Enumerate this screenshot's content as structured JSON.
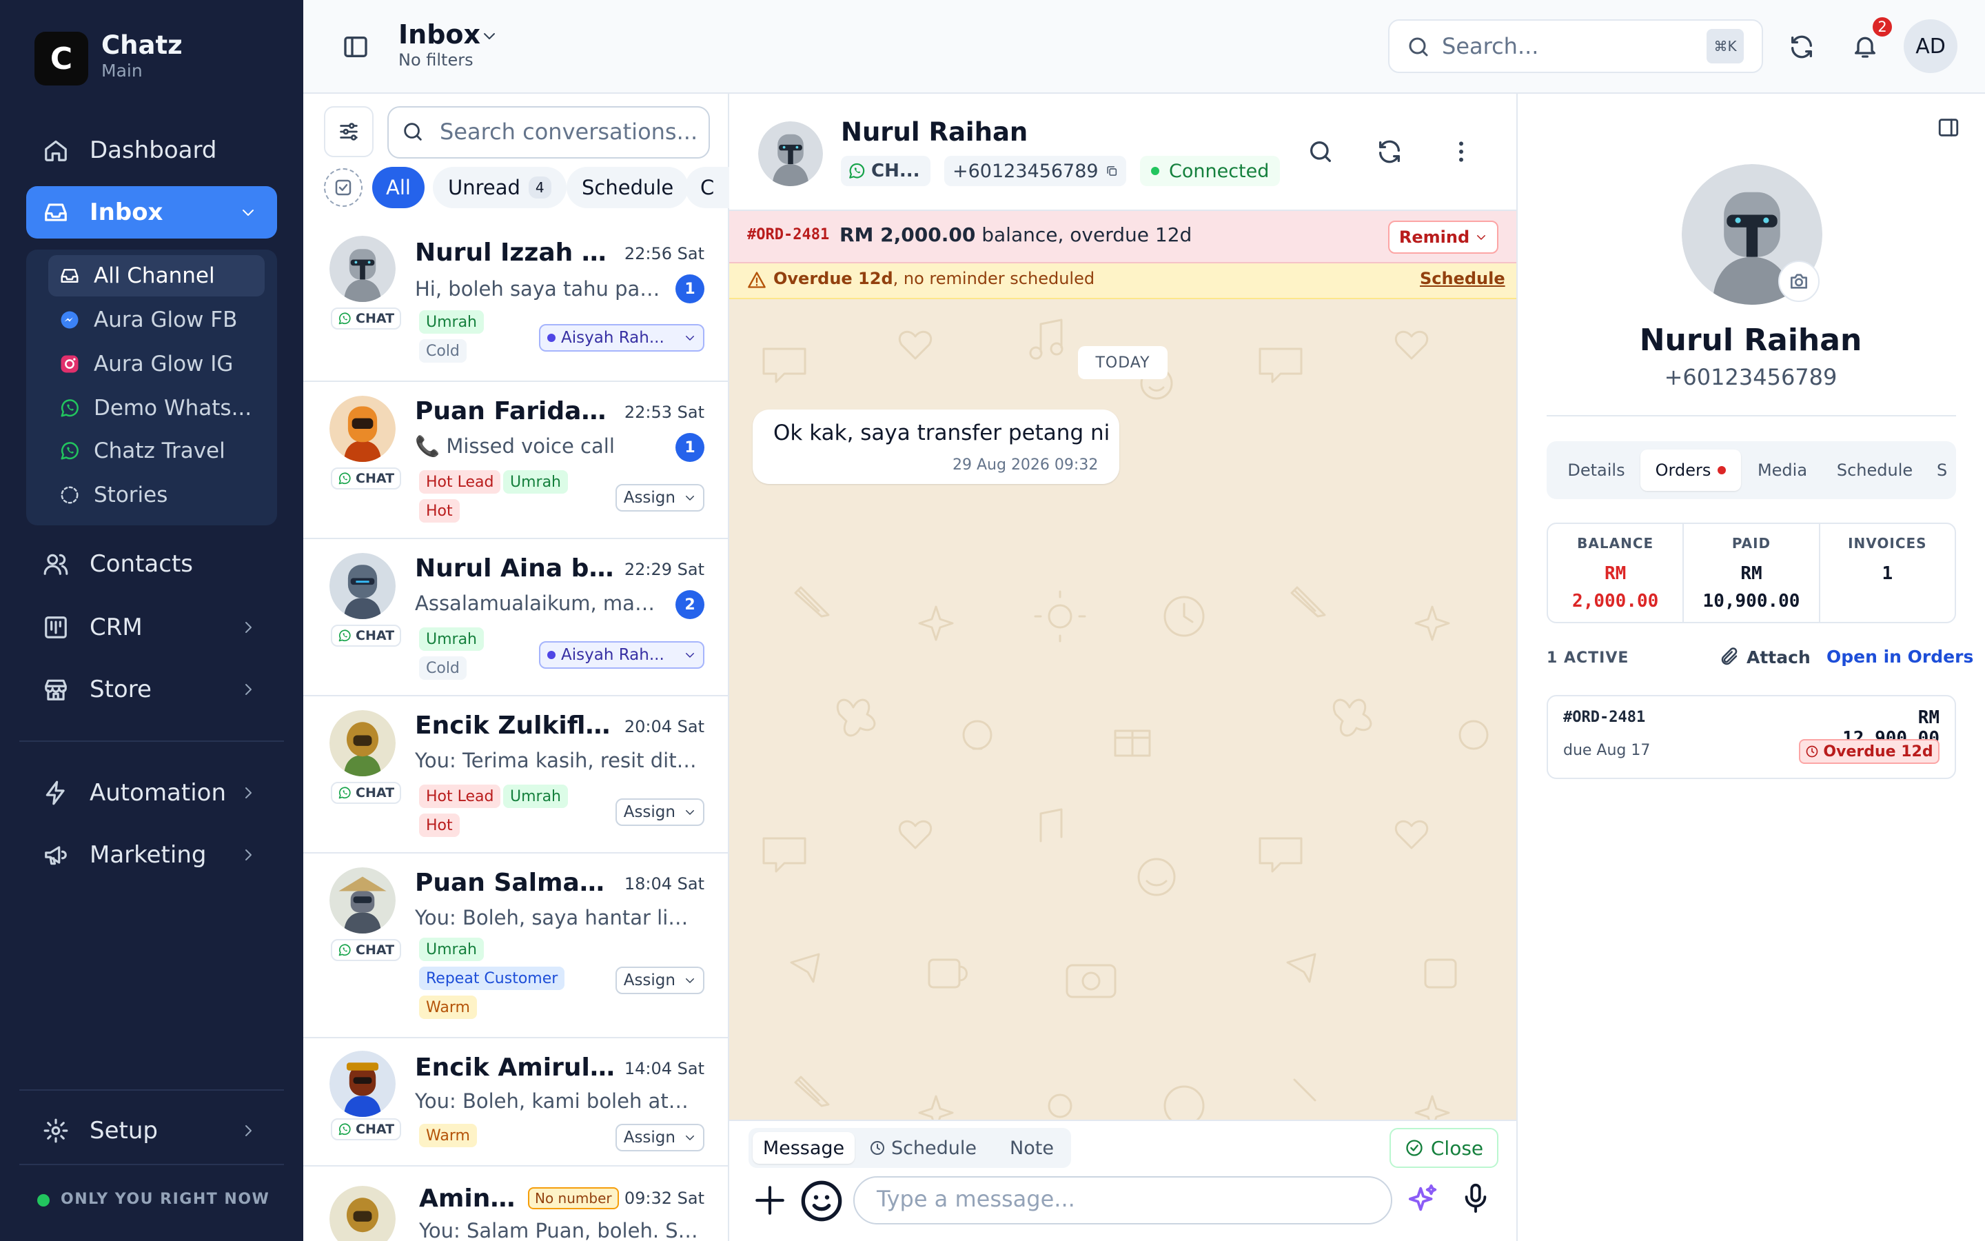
{
  "app": {
    "name": "Chatz",
    "workspace": "Main",
    "logo_text": "C"
  },
  "sidebar": {
    "dashboard": "Dashboard",
    "inbox": "Inbox",
    "channels": [
      "All Channel",
      "Aura Glow FB",
      "Aura Glow IG",
      "Demo Whats...",
      "Chatz Travel",
      "Stories"
    ],
    "contacts": "Contacts",
    "crm": "CRM",
    "store": "Store",
    "automation": "Automation",
    "marketing": "Marketing",
    "setup": "Setup",
    "status": "ONLY YOU RIGHT NOW"
  },
  "header": {
    "title": "Inbox",
    "filter": "No filters",
    "search_placeholder": "Search...",
    "search_shortcut": "⌘K",
    "notifications": "2",
    "user_initials": "AD"
  },
  "conversation_list": {
    "search_placeholder": "Search conversations...",
    "filters": {
      "all": "All",
      "unread": "Unread",
      "unread_count": "4",
      "schedule": "Schedule",
      "more": "C"
    },
    "chat_tag": "CHAT",
    "items": [
      {
        "name": "Nurul Izzah M...",
        "time": "22:56 Sat",
        "preview": "Hi, boleh saya tahu pakej...",
        "unread": "1",
        "tags": [
          "Umrah",
          "Cold"
        ],
        "assignee": "Aisyah Rah..."
      },
      {
        "name": "Puan Faridah ...",
        "time": "22:53 Sat",
        "preview": "📞 Missed voice call",
        "unread": "1",
        "tags": [
          "Hot Lead",
          "Umrah",
          "Hot"
        ],
        "assign": "Assign"
      },
      {
        "name": "Nurul Aina bin...",
        "time": "22:29 Sat",
        "preview": "Assalamualaikum, masih ...",
        "unread": "2",
        "tags": [
          "Umrah",
          "Cold"
        ],
        "assignee": "Aisyah Rah..."
      },
      {
        "name": "Encik Zulkifli ...",
        "time": "20:04 Sat",
        "preview": "You: Terima kasih, resit diteri...",
        "tags": [
          "Hot Lead",
          "Umrah",
          "Hot"
        ],
        "assign": "Assign"
      },
      {
        "name": "Puan Salmah I...",
        "time": "18:04 Sat",
        "preview": "You: Boleh, saya hantar link ...",
        "tags": [
          "Umrah",
          "Repeat Customer",
          "Warm"
        ],
        "assign": "Assign"
      },
      {
        "name": "Encik Amirul ...",
        "time": "14:04 Sat",
        "preview": "You: Boleh, kami boleh aturk...",
        "tags": [
          "Warm"
        ],
        "assign": "Assign"
      },
      {
        "name": "Amina...",
        "time": "09:32 Sat",
        "preview": "You: Salam Puan, boleh. Say...",
        "badge": "No number"
      }
    ]
  },
  "chat": {
    "contact_name": "Nurul Raihan",
    "channel_chip": "CH...",
    "phone": "+60123456789",
    "status": "Connected",
    "balance_order": "#ORD-2481",
    "balance_amount": "RM 2,000.00",
    "balance_rest": " balance, overdue 12d",
    "remind": "Remind",
    "overdue_bold": "Overdue 12d",
    "overdue_rest": ", no reminder scheduled",
    "schedule_link": "Schedule",
    "date_divider": "TODAY",
    "messages": [
      {
        "text": "Ok kak, saya transfer petang ni",
        "time": "29 Aug 2026 09:32"
      }
    ],
    "modes": [
      "Message",
      "Schedule",
      "Note"
    ],
    "close": "Close",
    "input_placeholder": "Type a message..."
  },
  "contact_panel": {
    "name": "Nurul Raihan",
    "phone": "+60123456789",
    "tabs": [
      "Details",
      "Orders",
      "Media",
      "Schedule",
      "S"
    ],
    "stats": [
      {
        "label": "BALANCE",
        "value_1": "RM",
        "value_2": "2,000.00"
      },
      {
        "label": "PAID",
        "value_1": "RM",
        "value_2": "10,900.00"
      },
      {
        "label": "INVOICES",
        "value_1": "1",
        "value_2": ""
      }
    ],
    "active_count": "1 ACTIVE",
    "attach": "Attach",
    "open_orders": "Open in Orders",
    "order": {
      "id": "#ORD-2481",
      "amount": "RM 12,900.00",
      "due": "due Aug 17",
      "status": "Overdue 12d"
    }
  },
  "colors": {
    "accent": "#3b82f6",
    "sidebar_bg": "#17203b",
    "danger": "#dc2626",
    "success": "#16a34a",
    "chat_bg": "#f4ead9"
  }
}
